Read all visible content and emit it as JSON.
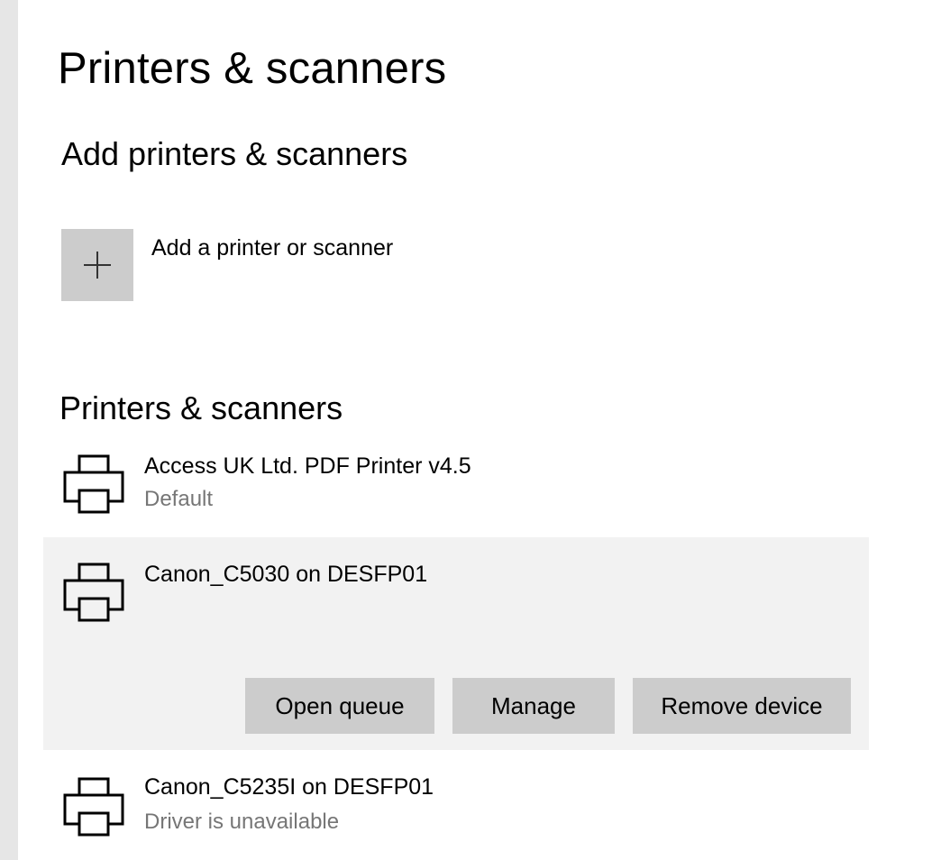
{
  "page": {
    "title": "Printers & scanners"
  },
  "add_section": {
    "heading": "Add printers & scanners",
    "button_label": "Add a printer or scanner",
    "button_icon": "plus-icon"
  },
  "list_section": {
    "heading": "Printers & scanners",
    "printers": [
      {
        "name": "Access UK Ltd. PDF Printer v4.5",
        "status": "Default",
        "icon": "printer-icon",
        "selected": false
      },
      {
        "name": "Canon_C5030 on DESFP01",
        "status": "",
        "icon": "printer-icon",
        "selected": true
      },
      {
        "name": "Canon_C5235I on DESFP01",
        "status": "Driver is unavailable",
        "icon": "printer-icon",
        "selected": false
      }
    ],
    "actions": {
      "open_queue": "Open queue",
      "manage": "Manage",
      "remove_device": "Remove device"
    }
  },
  "colors": {
    "sidebar_strip": "#e6e6e6",
    "tile_background": "#cccccc",
    "selected_row": "#f2f2f2",
    "secondary_text": "#767676",
    "button_background": "#cccccc"
  }
}
